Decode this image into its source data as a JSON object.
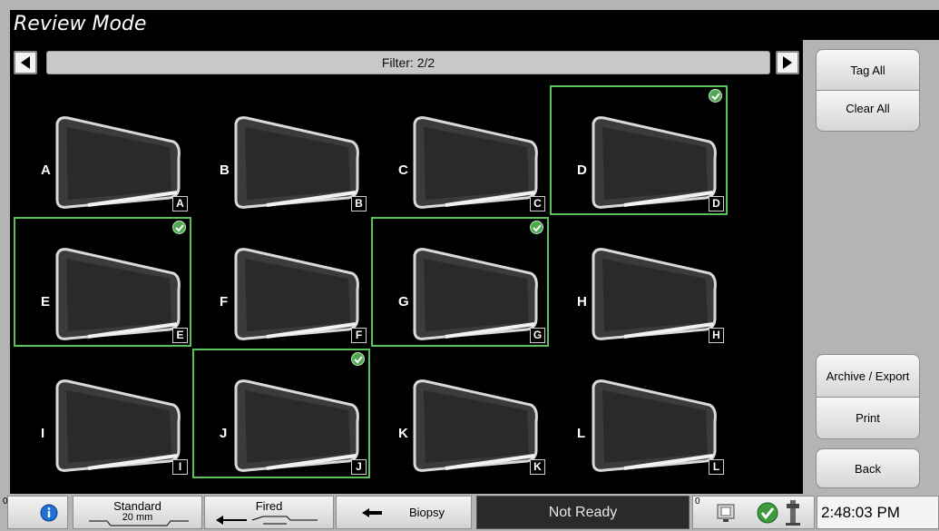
{
  "title": "Review Mode",
  "filter": {
    "label": "Filter: 2/2"
  },
  "thumbnails": [
    {
      "letter": "A",
      "tagged": false
    },
    {
      "letter": "B",
      "tagged": false
    },
    {
      "letter": "C",
      "tagged": false
    },
    {
      "letter": "D",
      "tagged": true
    },
    {
      "letter": "E",
      "tagged": true
    },
    {
      "letter": "F",
      "tagged": false
    },
    {
      "letter": "G",
      "tagged": true
    },
    {
      "letter": "H",
      "tagged": false
    },
    {
      "letter": "I",
      "tagged": false
    },
    {
      "letter": "J",
      "tagged": true
    },
    {
      "letter": "K",
      "tagged": false
    },
    {
      "letter": "L",
      "tagged": false
    }
  ],
  "side_buttons": {
    "tag_all": "Tag All",
    "clear_all": "Clear All",
    "archive_export": "Archive / Export",
    "print": "Print",
    "back": "Back"
  },
  "status": {
    "left_counter": "0",
    "info_icon": "info-icon",
    "paddle_label": "Standard",
    "paddle_size": "20 mm",
    "fired_label": "Fired",
    "biopsy_label": "Biopsy",
    "ready_state": "Not Ready",
    "right_counter": "0",
    "time": "2:48:03 PM"
  },
  "colors": {
    "selection": "#5cc05c",
    "panel": "#b4b4b4",
    "check": "#52a852"
  }
}
